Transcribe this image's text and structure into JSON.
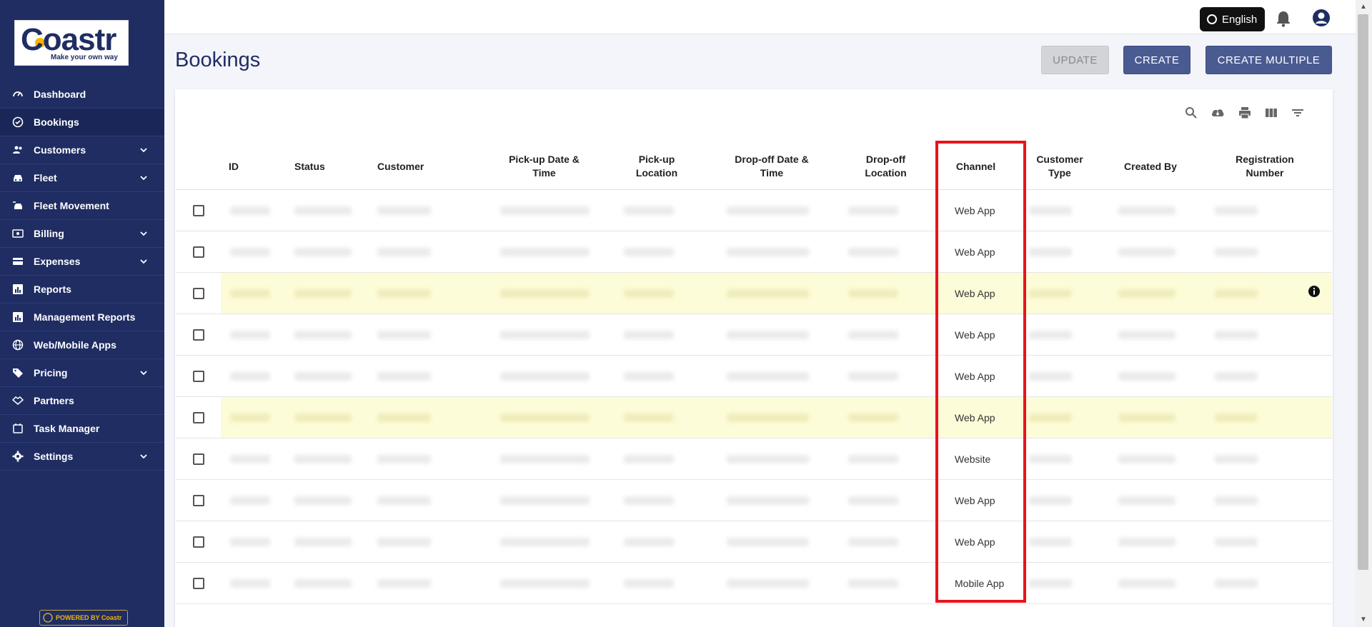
{
  "brand": {
    "logo_text": "Coastr",
    "tagline": "Make your own way",
    "powered_by": "POWERED BY Coastr"
  },
  "sidebar": {
    "items": [
      {
        "label": "Dashboard",
        "icon": "gauge-icon",
        "expandable": false
      },
      {
        "label": "Bookings",
        "icon": "check-circle-icon",
        "expandable": false,
        "active": true
      },
      {
        "label": "Customers",
        "icon": "users-icon",
        "expandable": true
      },
      {
        "label": "Fleet",
        "icon": "car-icon",
        "expandable": true
      },
      {
        "label": "Fleet Movement",
        "icon": "car-move-icon",
        "expandable": false
      },
      {
        "label": "Billing",
        "icon": "money-icon",
        "expandable": true
      },
      {
        "label": "Expenses",
        "icon": "card-icon",
        "expandable": true
      },
      {
        "label": "Reports",
        "icon": "bar-chart-icon",
        "expandable": false
      },
      {
        "label": "Management Reports",
        "icon": "bar-chart-icon",
        "expandable": false
      },
      {
        "label": "Web/Mobile Apps",
        "icon": "globe-icon",
        "expandable": false
      },
      {
        "label": "Pricing",
        "icon": "tag-icon",
        "expandable": true
      },
      {
        "label": "Partners",
        "icon": "handshake-icon",
        "expandable": false
      },
      {
        "label": "Task Manager",
        "icon": "calendar-icon",
        "expandable": false
      },
      {
        "label": "Settings",
        "icon": "gear-icon",
        "expandable": true
      }
    ]
  },
  "topbar": {
    "language": "English"
  },
  "page": {
    "title": "Bookings",
    "buttons": {
      "update": "UPDATE",
      "create": "CREATE",
      "create_multiple": "CREATE MULTIPLE"
    }
  },
  "table": {
    "columns": [
      "ID",
      "Status",
      "Customer",
      "Pick-up Date & Time",
      "Pick-up Location",
      "Drop-off Date & Time",
      "Drop-off Location",
      "Channel",
      "Customer Type",
      "Created By",
      "Registration Number"
    ],
    "rows": [
      {
        "channel": "Web App",
        "highlighted": false
      },
      {
        "channel": "Web App",
        "highlighted": false
      },
      {
        "channel": "Web App",
        "highlighted": true
      },
      {
        "channel": "Web App",
        "highlighted": false
      },
      {
        "channel": "Web App",
        "highlighted": false
      },
      {
        "channel": "Web App",
        "highlighted": true
      },
      {
        "channel": "Website",
        "highlighted": false
      },
      {
        "channel": "Web App",
        "highlighted": false
      },
      {
        "channel": "Web App",
        "highlighted": false
      },
      {
        "channel": "Mobile App",
        "highlighted": false
      }
    ]
  },
  "colors": {
    "sidebar_bg": "#1f2d63",
    "accent_button": "#4a5b92",
    "highlight_row": "#fdfcd8",
    "annotation_red": "#e8141c"
  }
}
